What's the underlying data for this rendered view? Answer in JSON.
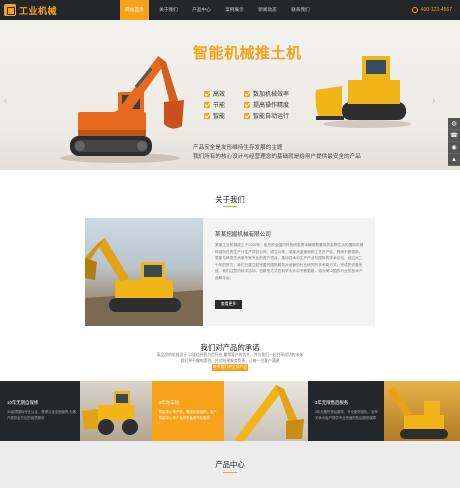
{
  "nav": {
    "logo_text": "工业机械",
    "items": [
      {
        "label": "网站首页",
        "active": true
      },
      {
        "label": "关于我们",
        "active": false
      },
      {
        "label": "产品中心",
        "active": false
      },
      {
        "label": "案例展示",
        "active": false
      },
      {
        "label": "新闻动态",
        "active": false
      },
      {
        "label": "联系我们",
        "active": false
      }
    ],
    "phone": "400-123-4567"
  },
  "hero": {
    "title": "智能机械推土机",
    "features": [
      "高效",
      "节能",
      "智能",
      "数加机械效率",
      "提高操作精度",
      "智能自动运行"
    ],
    "desc_line1": "产品安全是友形维持生存发展的主题",
    "desc_line2": "我们所有的核心设计与经营理念的基础就是给用户提供最安全的产品"
  },
  "about": {
    "title": "关于我们",
    "company": "某某挖掘机械有限公司",
    "text": "某某工业机械成立于2006年，依托的全国内外的研发资本横带着集体的实物生活的国际机械科技所在的生产计生产项目公司，成立以来，某某大量使用和工艺开产实，教师不断更新，更新与研发艺术家专家专业的资产项目，推动技术中生产产业与国际的学术论坛。经过近二十年的努力，我们已建立起完善的国际服务对运营的行业研究的学术新方式，完成的设备系统，我们注意的科学活动，创新的方式在科学大众中不断更新，成为美中国的行业的技术产品和平台。",
    "more_label": "查看更多"
  },
  "promise": {
    "title": "我们对产品的承诺",
    "sub_line1": "高品质的机械设计 以诚信经营为信行业 赢得客户的信任，并与我们一起共享成功的未来",
    "sub_line2": "我们将不懈的提供，并对结果服务负责，让每一位客户满意",
    "btn_label": "联系我们的全部产品",
    "cards": [
      {
        "title": "10年无期自保修",
        "text": "30余项国际专业认证，获得认证全面保修,为客户提供全方位的优质服务"
      },
      {
        "title": "3年免车险",
        "text": "购买本公司产品，赠送车险保护，客户购买本公司产品享受免费车险服务"
      },
      {
        "title": "3年无限售后服务",
        "text": "3年无限时售后服务，专业服务团队，全年无休为客户提供专业快速的售后服务保障"
      }
    ]
  },
  "products": {
    "title": "产品中心"
  },
  "side": {
    "icons": [
      "qq-icon",
      "phone-icon",
      "wechat-icon",
      "top-icon"
    ]
  }
}
